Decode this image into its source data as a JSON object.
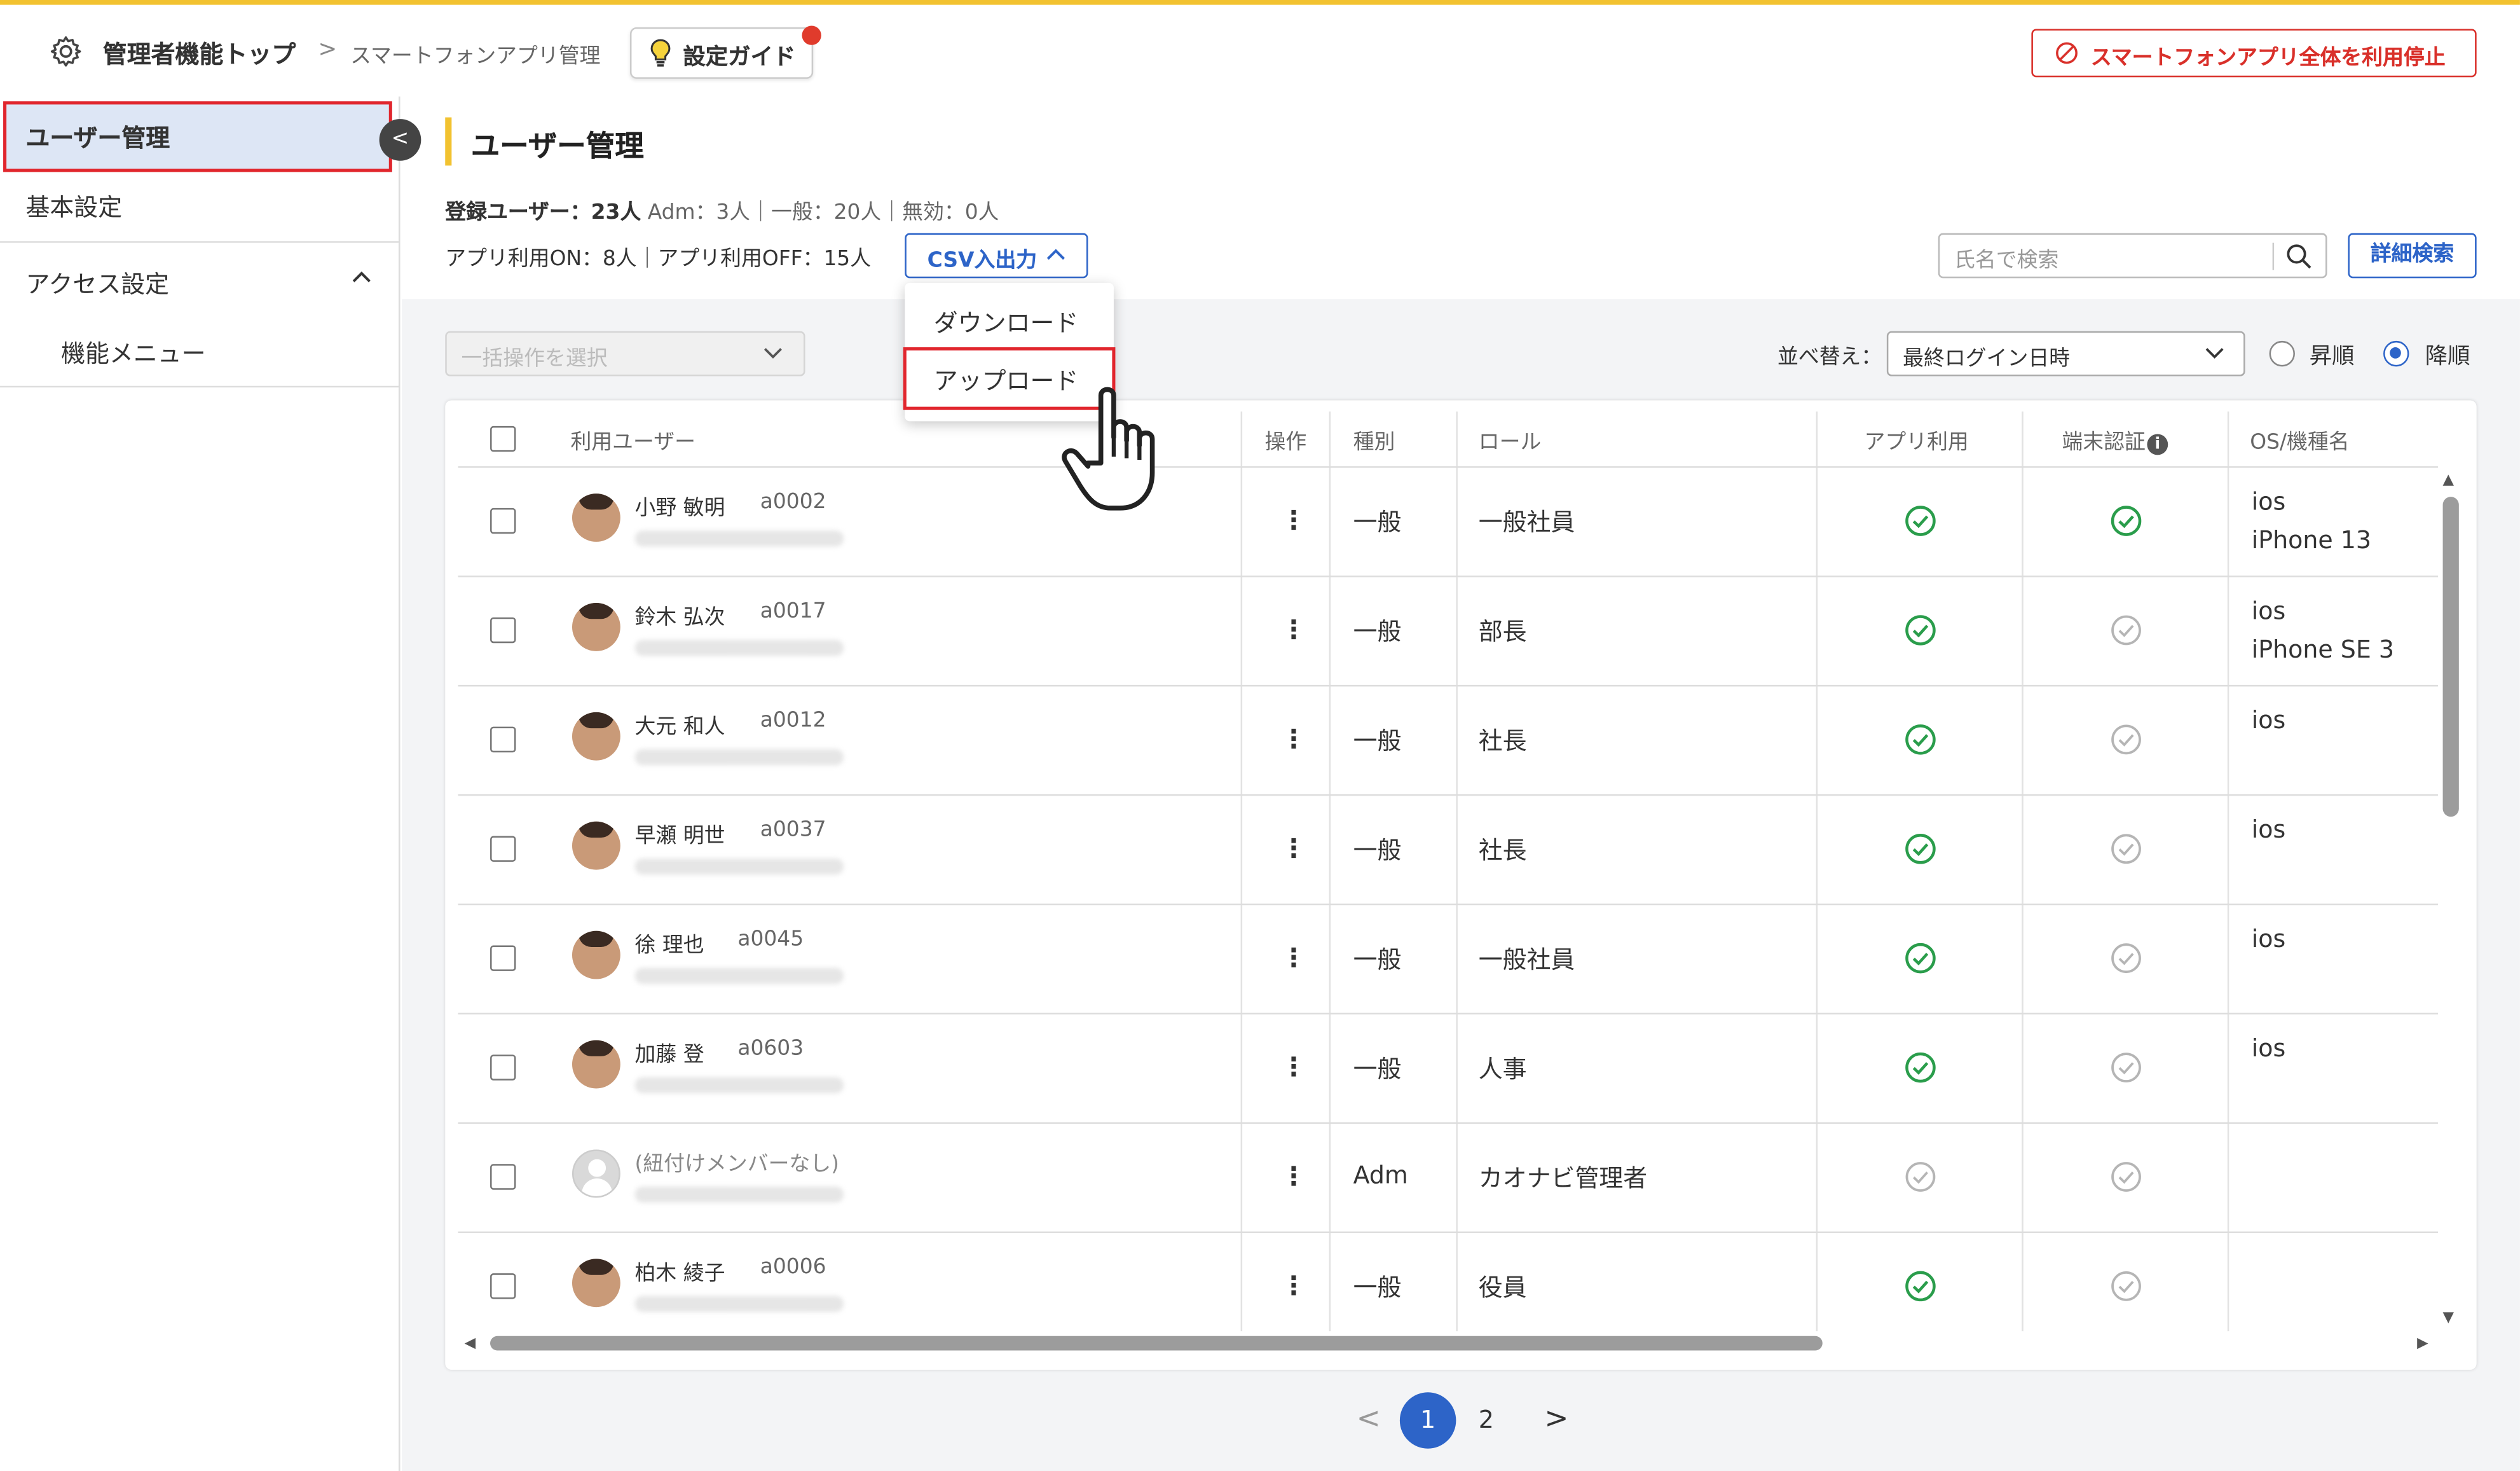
{
  "header": {
    "breadcrumb_root": "管理者機能トップ",
    "breadcrumb_sep": ">",
    "breadcrumb_current": "スマートフォンアプリ管理",
    "guide_button": "設定ガイド",
    "stop_button": "スマートフォンアプリ全体を利用停止"
  },
  "sidebar": {
    "active_item": "ユーザー管理",
    "collapse_glyph": "<",
    "items": [
      {
        "label": "基本設定"
      },
      {
        "label": "アクセス設定"
      },
      {
        "label": "機能メニュー"
      }
    ]
  },
  "main": {
    "title": "ユーザー管理",
    "stats_registered": "登録ユーザー：23人",
    "stats_breakdown": "Adm：3人｜一般：20人｜無効：0人",
    "stats_app": "アプリ利用ON：8人｜アプリ利用OFF：15人",
    "csv_button": "CSV入出力",
    "search_placeholder": "氏名で検索",
    "advanced_search": "詳細検索",
    "bulk_placeholder": "一括操作を選択",
    "sort_label": "並べ替え：",
    "sort_value": "最終ログイン日時",
    "sort_asc": "昇順",
    "sort_desc": "降順",
    "sort_selected": "降順"
  },
  "dropdown": {
    "items": [
      "ダウンロード",
      "アップロード"
    ],
    "highlighted": "アップロード"
  },
  "table": {
    "columns": [
      "利用ユーザー",
      "操作",
      "種別",
      "ロール",
      "アプリ利用",
      "端末認証",
      "OS/機種名"
    ],
    "rows": [
      {
        "name": "小野 敏明",
        "id": "a0002",
        "type": "一般",
        "role": "一般社員",
        "app": true,
        "device": true,
        "os": "ios",
        "model": "iPhone 13"
      },
      {
        "name": "鈴木 弘次",
        "id": "a0017",
        "type": "一般",
        "role": "部長",
        "app": true,
        "device": false,
        "os": "ios",
        "model": "iPhone SE 3"
      },
      {
        "name": "大元 和人",
        "id": "a0012",
        "type": "一般",
        "role": "社長",
        "app": true,
        "device": false,
        "os": "ios",
        "model": ""
      },
      {
        "name": "早瀬 明世",
        "id": "a0037",
        "type": "一般",
        "role": "社長",
        "app": true,
        "device": false,
        "os": "ios",
        "model": ""
      },
      {
        "name": "徐 理也",
        "id": "a0045",
        "type": "一般",
        "role": "一般社員",
        "app": true,
        "device": false,
        "os": "ios",
        "model": ""
      },
      {
        "name": "加藤 登",
        "id": "a0603",
        "type": "一般",
        "role": "人事",
        "app": true,
        "device": false,
        "os": "ios",
        "model": ""
      },
      {
        "name": "(紐付けメンバーなし)",
        "id": "",
        "type": "Adm",
        "role": "カオナビ管理者",
        "app": false,
        "device": false,
        "os": "",
        "model": ""
      },
      {
        "name": "柏木 綾子",
        "id": "a0006",
        "type": "一般",
        "role": "役員",
        "app": true,
        "device": false,
        "os": "",
        "model": ""
      }
    ]
  },
  "pagination": {
    "prev": "<",
    "current": "1",
    "next_page": "2",
    "next": ">"
  },
  "colors": {
    "accent": "#2d64c8",
    "danger": "#d9302a",
    "highlight": "#e1262d",
    "success": "#2a9d4b",
    "title_bar": "#f2c230"
  },
  "icons": [
    "gear-icon",
    "lightbulb-icon",
    "ban-icon",
    "search-icon",
    "chevron-up-icon",
    "chevron-down-icon",
    "kebab-icon",
    "check-circle-icon",
    "info-icon",
    "hand-pointer-icon"
  ]
}
